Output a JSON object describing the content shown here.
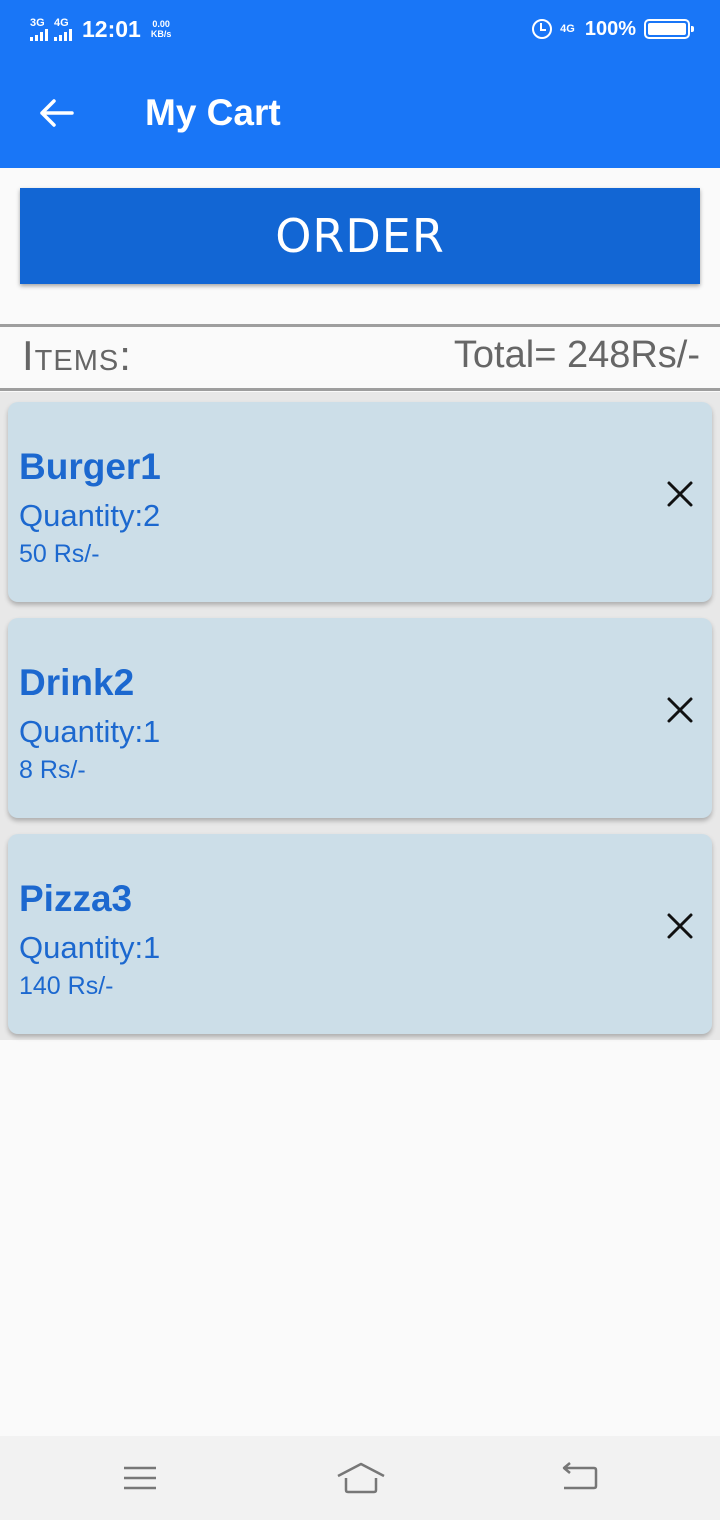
{
  "status_bar": {
    "signal1": "3G",
    "signal2": "4G",
    "time": "12:01",
    "speed_value": "0.00",
    "speed_unit": "KB/s",
    "network": "4G",
    "battery": "100%"
  },
  "app_bar": {
    "title": "My Cart"
  },
  "order_button": {
    "label": "ORDER"
  },
  "summary": {
    "items_label": "Items:",
    "total_label": "Total= 248Rs/-"
  },
  "cart_items": [
    {
      "name": "Burger1",
      "quantity": "Quantity:2",
      "price": "50 Rs/-"
    },
    {
      "name": "Drink2",
      "quantity": "Quantity:1",
      "price": "8 Rs/-"
    },
    {
      "name": "Pizza3",
      "quantity": "Quantity:1",
      "price": "140 Rs/-"
    }
  ],
  "colors": {
    "primary": "#1976f7",
    "button": "#1266d4",
    "card": "#ccdee8",
    "item_text": "#1c68cf"
  },
  "icons": {
    "back": "arrow-left-icon",
    "remove": "close-icon",
    "menu": "menu-icon",
    "home": "home-icon",
    "return": "back-icon"
  }
}
